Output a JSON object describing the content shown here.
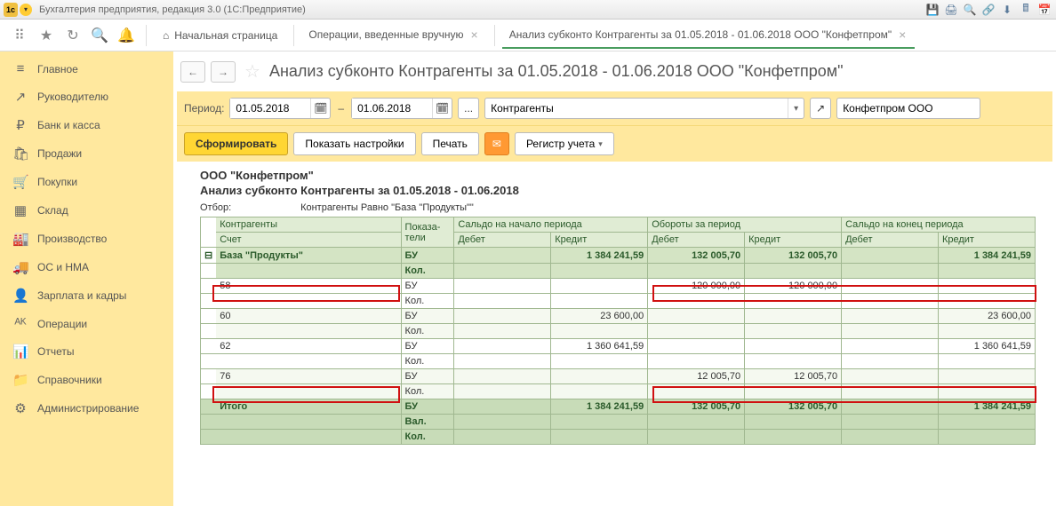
{
  "window": {
    "title": "Бухгалтерия предприятия, редакция 3.0  (1С:Предприятие)"
  },
  "tabs": {
    "home": "Начальная страница",
    "t1": "Операции, введенные вручную",
    "t2": "Анализ субконто Контрагенты за 01.05.2018 - 01.06.2018 ООО \"Конфетпром\""
  },
  "sidebar": {
    "items": [
      {
        "icon": "≡",
        "label": "Главное"
      },
      {
        "icon": "↗",
        "label": "Руководителю"
      },
      {
        "icon": "₽",
        "label": "Банк и касса"
      },
      {
        "icon": "🛍",
        "label": "Продажи"
      },
      {
        "icon": "🛒",
        "label": "Покупки"
      },
      {
        "icon": "▦",
        "label": "Склад"
      },
      {
        "icon": "🏭",
        "label": "Производство"
      },
      {
        "icon": "🚚",
        "label": "ОС и НМА"
      },
      {
        "icon": "👤",
        "label": "Зарплата и кадры"
      },
      {
        "icon": "ᴬᴷ",
        "label": "Операции"
      },
      {
        "icon": "📊",
        "label": "Отчеты"
      },
      {
        "icon": "📁",
        "label": "Справочники"
      },
      {
        "icon": "⚙",
        "label": "Администрирование"
      }
    ]
  },
  "page": {
    "title": "Анализ субконто Контрагенты за 01.05.2018 - 01.06.2018 ООО \"Конфетпром\""
  },
  "period": {
    "label": "Период:",
    "from": "01.05.2018",
    "to": "01.06.2018",
    "subconto": "Контрагенты",
    "org": "Конфетпром ООО"
  },
  "actions": {
    "form": "Сформировать",
    "settings": "Показать настройки",
    "print": "Печать",
    "register": "Регистр учета"
  },
  "report": {
    "org": "ООО \"Конфетпром\"",
    "title": "Анализ субконто Контрагенты за 01.05.2018 - 01.06.2018",
    "filter_label": "Отбор:",
    "filter_value": "Контрагенты Равно \"База \"Продукты\"\" ",
    "headers": {
      "col1a": "Контрагенты",
      "col1b": "Счет",
      "col2": "Показа-тели",
      "g1": "Сальдо на начало периода",
      "g2": "Обороты за период",
      "g3": "Сальдо на конец периода",
      "deb": "Дебет",
      "cred": "Кредит"
    },
    "rows": {
      "group": {
        "name": "База \"Продукты\"",
        "ind1": "БУ",
        "ind2": "Кол.",
        "sb_cred": "1 384 241,59",
        "ob_deb": "132 005,70",
        "ob_cred": "132 005,70",
        "se_cred": "1 384 241,59"
      },
      "r58": {
        "acc": "58",
        "ind1": "БУ",
        "ind2": "Кол.",
        "ob_deb": "120 000,00",
        "ob_cred": "120 000,00"
      },
      "r60": {
        "acc": "60",
        "ind1": "БУ",
        "ind2": "Кол.",
        "sb_cred": "23 600,00",
        "se_cred": "23 600,00"
      },
      "r62": {
        "acc": "62",
        "ind1": "БУ",
        "ind2": "Кол.",
        "sb_cred": "1 360 641,59",
        "se_cred": "1 360 641,59"
      },
      "r76": {
        "acc": "76",
        "ind1": "БУ",
        "ind2": "Кол.",
        "ob_deb": "12 005,70",
        "ob_cred": "12 005,70"
      },
      "total": {
        "name": "Итого",
        "ind1": "БУ",
        "ind2": "Вал.",
        "ind3": "Кол.",
        "sb_cred": "1 384 241,59",
        "ob_deb": "132 005,70",
        "ob_cred": "132 005,70",
        "se_cred": "1 384 241,59"
      }
    }
  }
}
